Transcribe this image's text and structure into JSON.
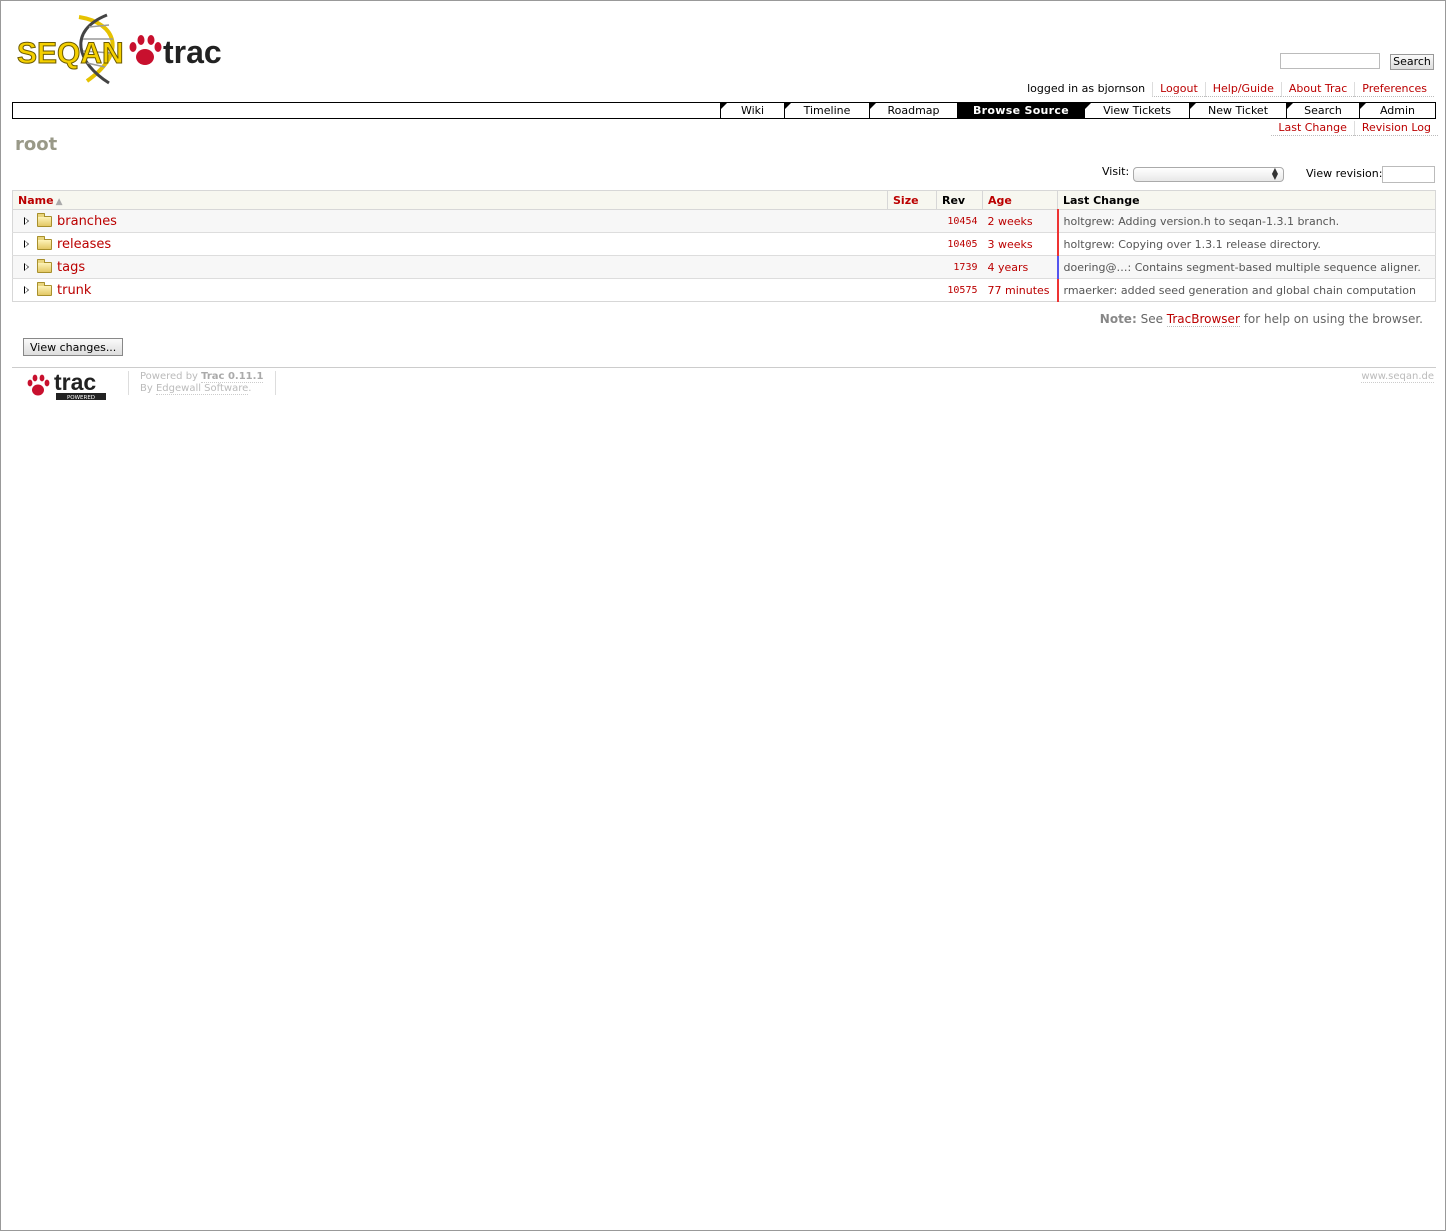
{
  "header": {
    "logo_text_left": "SEQAN",
    "logo_text_right": "trac",
    "search_button": "Search",
    "search_value": ""
  },
  "metanav": {
    "logged_in": "logged in as bjornson",
    "items": [
      "Logout",
      "Help/Guide",
      "About Trac",
      "Preferences"
    ]
  },
  "mainnav": {
    "tabs": [
      {
        "label": "Wiki"
      },
      {
        "label": "Timeline"
      },
      {
        "label": "Roadmap"
      },
      {
        "label": "Browse Source",
        "active": true
      },
      {
        "label": "View Tickets"
      },
      {
        "label": "New Ticket"
      },
      {
        "label": "Search"
      },
      {
        "label": "Admin"
      }
    ]
  },
  "ctxtnav": {
    "items": [
      "Last Change",
      "Revision Log"
    ]
  },
  "page": {
    "title": "root",
    "visit_label": "Visit:",
    "visit_value": "",
    "view_revision_label": "View revision:",
    "view_revision_value": ""
  },
  "listing": {
    "columns": [
      "Name",
      "Size",
      "Rev",
      "Age",
      "Last Change"
    ],
    "rows": [
      {
        "name": "branches",
        "size": "",
        "rev": "10454",
        "age": "2 weeks",
        "change": "holtgrew: Adding version.h to seqan-1.3.1 branch."
      },
      {
        "name": "releases",
        "size": "",
        "rev": "10405",
        "age": "3 weeks",
        "change": "holtgrew: Copying over 1.3.1 release directory."
      },
      {
        "name": "tags",
        "size": "",
        "rev": "1739",
        "age": "4 years",
        "change": "doering@…: Contains segment-based multiple sequence aligner."
      },
      {
        "name": "trunk",
        "size": "",
        "rev": "10575",
        "age": "77 minutes",
        "change": "rmaerker: added seed generation and global chain computation"
      }
    ]
  },
  "note": {
    "label": "Note:",
    "pre": "See",
    "link": "TracBrowser",
    "post": "for help on using the browser."
  },
  "view_changes_button": "View changes...",
  "footer": {
    "powered_logo_text": "trac",
    "powered_logo_sub": "POWERED",
    "powered_by": "Powered by",
    "trac_version": "Trac 0.11.1",
    "by": "By",
    "vendor": "Edgewall Software",
    "site": "www.seqan.de"
  }
}
